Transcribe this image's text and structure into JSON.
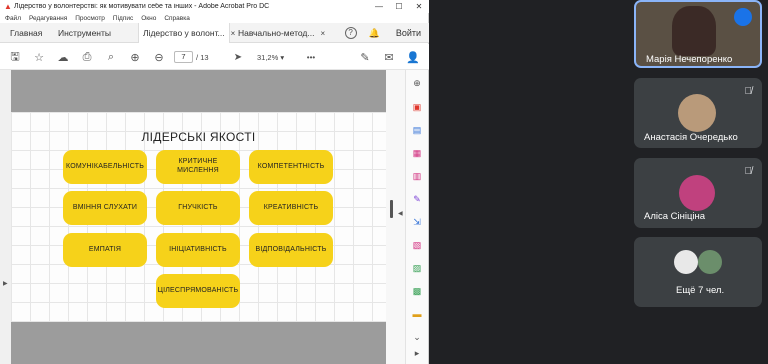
{
  "window": {
    "title": "Лідерство у волонтерстві: як мотивувати себе та інших - Adobe Acrobat Pro DC",
    "controls": [
      "—",
      "☐",
      "✕"
    ]
  },
  "menu": [
    "Файл",
    "Редагування",
    "Просмотр",
    "Підпис",
    "Окно",
    "Справка"
  ],
  "tabs": {
    "home": "Главная",
    "tools": "Инструменты",
    "doc1": "Лідерство у волонт...",
    "doc2": "Навчально-метод...",
    "close": "×",
    "help": "?",
    "bell": "🔔",
    "login": "Войти"
  },
  "toolbar": {
    "page_current": "7",
    "page_separator": "/",
    "page_total": "13",
    "zoom": "31,2%",
    "more": "•••"
  },
  "slide": {
    "title": "ЛІДЕРСЬКІ ЯКОСТІ",
    "qualities": [
      "КОМУНІКАБЕЛЬНІСТЬ",
      "КРИТИЧНЕ МИСЛЕННЯ",
      "КОМПЕТЕНТНІСТЬ",
      "ВМІННЯ СЛУХАТИ",
      "ГНУЧКІСТЬ",
      "КРЕАТИВНІСТЬ",
      "ЕМПАТІЯ",
      "ІНІЦІАТИВНІСТЬ",
      "ВІДПОВІДАЛЬНІСТЬ",
      "ЦІЛЕСПРЯМОВАНІСТЬ"
    ]
  },
  "participants": [
    {
      "name": "Марія Нечепоренко",
      "status": "speaking"
    },
    {
      "name": "Анастасія Очередько",
      "status": "muted"
    },
    {
      "name": "Аліса Сініціна",
      "status": "muted"
    }
  ],
  "more_participants": "Ещё 7 чел.",
  "colors": {
    "accent_yellow": "#f6d21a",
    "meet_tile": "#3c4043",
    "meet_bg": "#202124",
    "speaking_blue": "#1a73e8",
    "acrobat_red": "#e0362c"
  }
}
